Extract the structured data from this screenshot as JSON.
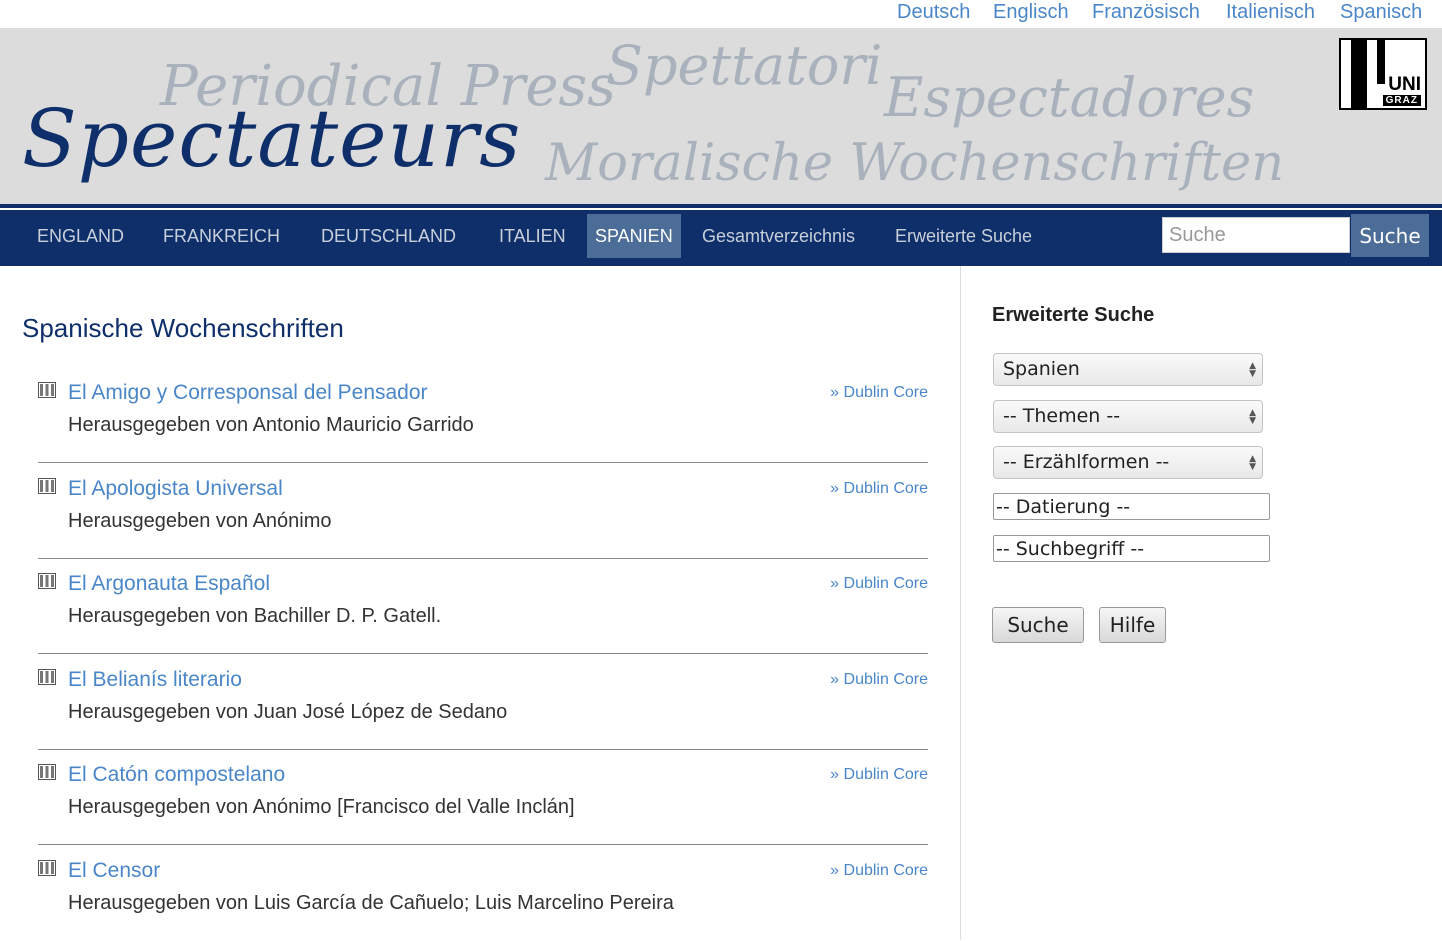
{
  "languages": [
    "Deutsch",
    "Englisch",
    "Französisch",
    "Italienisch",
    "Spanisch"
  ],
  "banner": {
    "title": "Spectateurs",
    "bg_words": [
      "Periodical Press",
      "Spettatori",
      "Espectadores",
      "Moralische Wochenschriften"
    ],
    "logo_uni": "UNI",
    "logo_graz": "GRAZ"
  },
  "nav": {
    "items": [
      "ENGLAND",
      "FRANKREICH",
      "DEUTSCHLAND",
      "ITALIEN",
      "SPANIEN",
      "Gesamtverzeichnis",
      "Erweiterte Suche"
    ],
    "active": "SPANIEN",
    "search_placeholder": "Suche",
    "search_button": "Suche"
  },
  "main": {
    "title": "Spanische Wochenschriften",
    "entries": [
      {
        "title": "El Amigo y Corresponsal del Pensador",
        "editor": "Herausgegeben von Antonio Mauricio Garrido",
        "link": "» Dublin Core"
      },
      {
        "title": "El Apologista Universal",
        "editor": "Herausgegeben von Anónimo",
        "link": "» Dublin Core"
      },
      {
        "title": "El Argonauta Español",
        "editor": "Herausgegeben von Bachiller D. P. Gatell.",
        "link": "» Dublin Core"
      },
      {
        "title": "El Belianís literario",
        "editor": "Herausgegeben von Juan José López de Sedano",
        "link": "» Dublin Core"
      },
      {
        "title": "El Catón compostelano",
        "editor": "Herausgegeben von Anónimo [Francisco del Valle Inclán]",
        "link": "» Dublin Core"
      },
      {
        "title": "El Censor",
        "editor": "Herausgegeben von Luis García de Cañuelo; Luis Marcelino Pereira",
        "link": "» Dublin Core"
      }
    ]
  },
  "sidebar": {
    "heading": "Erweiterte Suche",
    "country_select": "Spanien",
    "themes_select": "-- Themen --",
    "forms_select": "-- Erzählformen --",
    "date_field": "-- Datierung --",
    "term_field": "-- Suchbegriff --",
    "search_button": "Suche",
    "help_button": "Hilfe"
  },
  "colors": {
    "brand": "#0e2f6a",
    "link": "#4a86c8",
    "active_nav": "#4b6d98",
    "banner_bg": "#dcdcdc"
  }
}
